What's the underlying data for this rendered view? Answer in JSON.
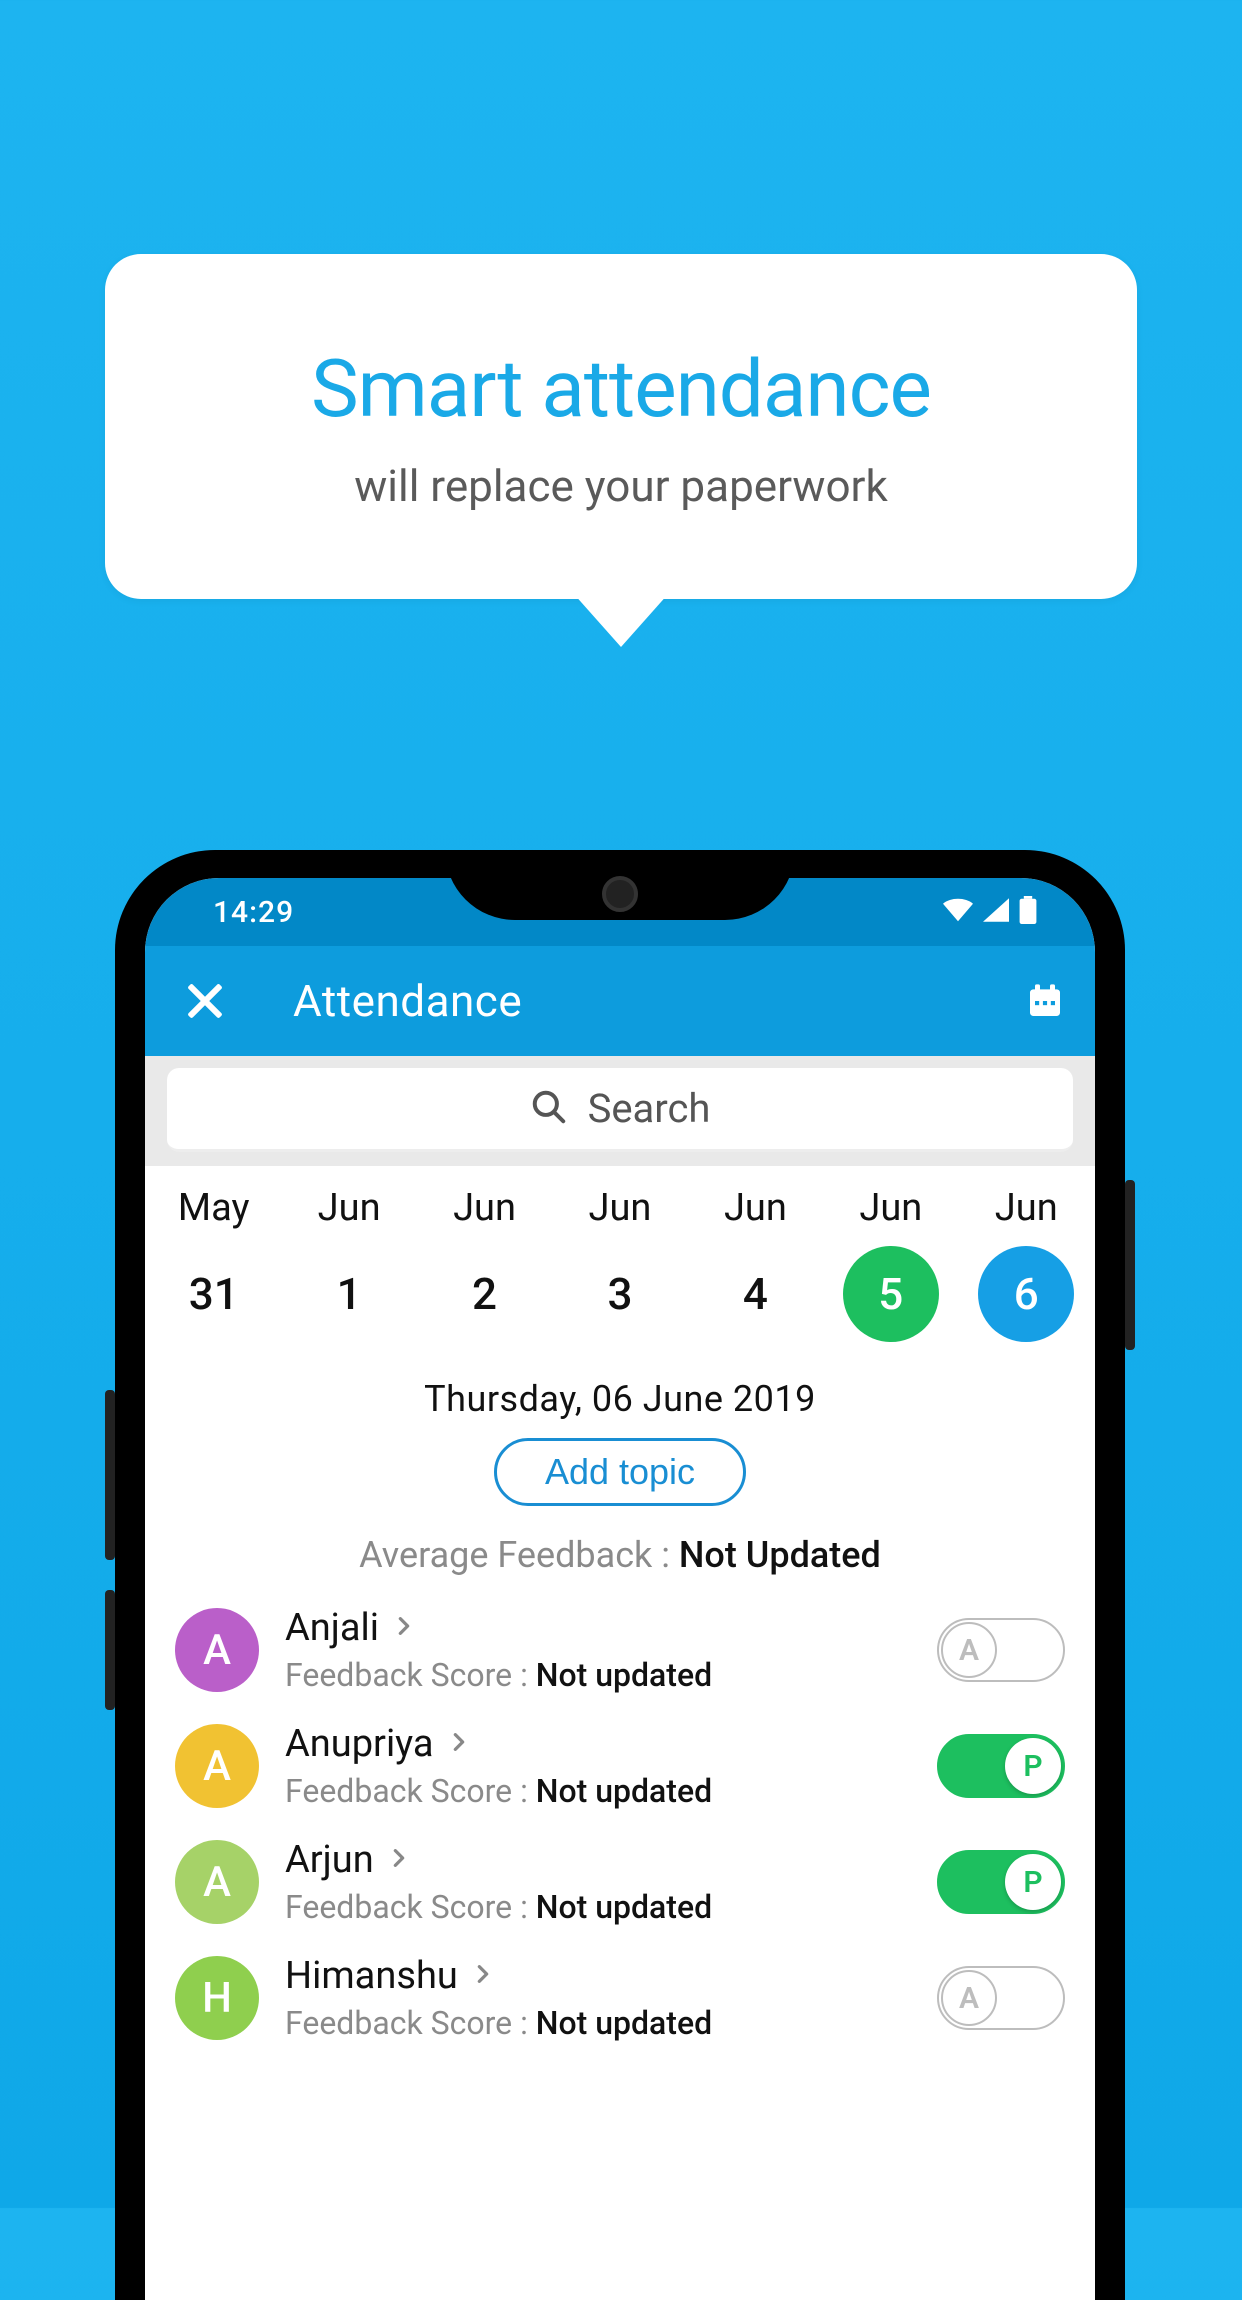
{
  "caption": {
    "title": "Smart attendance",
    "subtitle": "will replace your paperwork"
  },
  "statusbar": {
    "time": "14:29"
  },
  "appbar": {
    "title": "Attendance"
  },
  "search": {
    "placeholder": "Search"
  },
  "dates": [
    {
      "month": "May",
      "day": "31",
      "style": "plain"
    },
    {
      "month": "Jun",
      "day": "1",
      "style": "plain"
    },
    {
      "month": "Jun",
      "day": "2",
      "style": "plain"
    },
    {
      "month": "Jun",
      "day": "3",
      "style": "plain"
    },
    {
      "month": "Jun",
      "day": "4",
      "style": "plain"
    },
    {
      "month": "Jun",
      "day": "5",
      "style": "green"
    },
    {
      "month": "Jun",
      "day": "6",
      "style": "blue"
    }
  ],
  "selected_date": "Thursday, 06 June 2019",
  "add_topic_label": "Add topic",
  "avg_feedback": {
    "label": "Average Feedback : ",
    "value": "Not Updated"
  },
  "feedback_label": "Feedback Score : ",
  "students": [
    {
      "name": "Anjali",
      "initial": "A",
      "avatar_color": "#ba5fc9",
      "feedback": "Not updated",
      "toggle": "off",
      "toggle_text": "A"
    },
    {
      "name": "Anupriya",
      "initial": "A",
      "avatar_color": "#f1c232",
      "feedback": "Not updated",
      "toggle": "on",
      "toggle_text": "P"
    },
    {
      "name": "Arjun",
      "initial": "A",
      "avatar_color": "#a6d268",
      "feedback": "Not updated",
      "toggle": "on",
      "toggle_text": "P"
    },
    {
      "name": "Himanshu",
      "initial": "H",
      "avatar_color": "#8fcf4e",
      "feedback": "Not updated",
      "toggle": "off",
      "toggle_text": "A"
    }
  ]
}
